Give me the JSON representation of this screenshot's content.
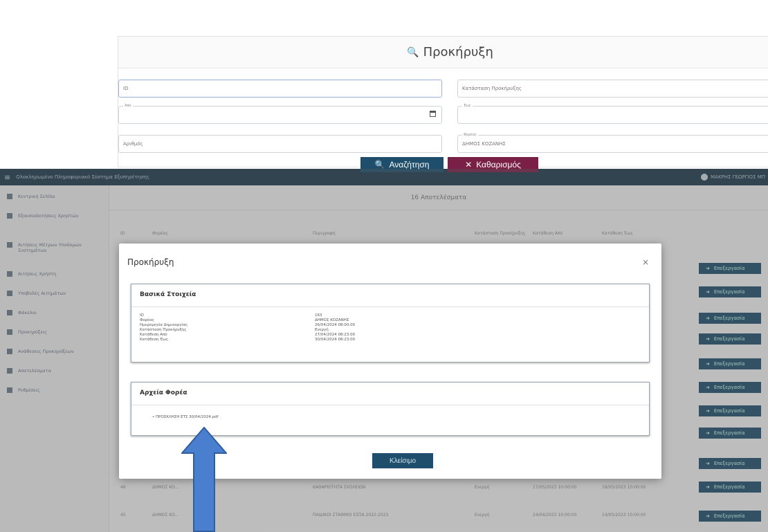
{
  "search": {
    "title": "Προκήρυξη",
    "fields": {
      "id": "ID",
      "description": "Κατάσταση Προκήρυξης",
      "from_label": "Από",
      "to_label": "Έως",
      "number": "Αριθμός",
      "carrier_label": "Φορέας",
      "carrier_value": "ΔΗΜΟΣ ΚΟΖΑΝΗΣ"
    },
    "search_button": "Αναζήτηση",
    "clear_button": "Καθαρισμός"
  },
  "app_bar": {
    "title": "Ολοκληρωμένο Πληροφοριακό Σύστημα Εξυπηρέτησης",
    "user": "ΜΑΚΡΗΣ ΓΕΩΡΓΙΟΣ ΜΠ"
  },
  "sidebar": {
    "items": [
      {
        "label": "Κεντρική Σελίδα",
        "icon": "home-icon"
      },
      {
        "label": "Εξουσιοδοτήσεις Χρηστών",
        "icon": "users-icon"
      },
      {
        "label": "Αιτήσεις Μέτρων Υποδομών Συστημάτων",
        "icon": "chart-icon"
      },
      {
        "label": "Αιτήσεις Χρήστη",
        "icon": "list-icon"
      },
      {
        "label": "Υποβολές Αιτημάτων",
        "icon": "filter-icon"
      },
      {
        "label": "Φάκελοι",
        "icon": "calendar-icon"
      },
      {
        "label": "Προκηρύξεις",
        "icon": "star-icon"
      },
      {
        "label": "Ανάθεσεις Προκηρύξεων",
        "icon": "key-icon"
      },
      {
        "label": "Αποτελέσματα",
        "icon": "check-icon"
      },
      {
        "label": "Ρυθμίσεις",
        "icon": "card-icon"
      }
    ]
  },
  "results": {
    "title": "16 Αποτελέσματα",
    "columns": [
      "ID",
      "Φορέας",
      "Περιγραφή",
      "Κατάσταση Προκήρυξης",
      "Κατάθεση Από",
      "Κατάθεση Έως"
    ],
    "edit_label": "Επεξεργασία",
    "rows": [
      [
        "46",
        "ΔΗΜΟΣ ΚΟ...",
        "ΚΑΘΑΡΙΟΤΗΤΑ ΣΧΟΛΕΙΩΝ",
        "Ενεργή",
        "17/05/2023 10:00:00",
        "18/05/2023 10:00:00"
      ],
      [
        "45",
        "ΔΗΜΟΣ ΚΟ...",
        "ΠΑΙΔΙΚΟΙ ΣΤΑΘΜΟΙ ΕΣΠΑ 2022-2023",
        "Ενεργή",
        "24/04/2023 10:00:00",
        "14/05/2023 10:00:00"
      ]
    ]
  },
  "modal": {
    "title": "Προκήρυξη",
    "basic_title": "Βασικά Στοιχεία",
    "labels": [
      "ID",
      "Φορέας",
      "Ημερομηνία Δημιουργίας",
      "Κατάσταση Προκήρυξης",
      "Κατάθεση Από",
      "Κατάθεση Έως"
    ],
    "values": [
      "163",
      "ΔΗΜΟΣ ΚΟΖΑΝΗΣ",
      "26/04/2024 08:00:00",
      "Ενεργή",
      "27/04/2024 08:23:00",
      "30/04/2024 08:23:00"
    ],
    "files_title": "Αρχεία Φορέα",
    "file_item": "• ΠΡΟΣΚΛΗΣΗ ΕΤΣ 30/04/2024.pdf",
    "close_button": "Κλείσιμο"
  },
  "colors": {
    "primary": "#1e4e6b",
    "danger": "#7a1f45",
    "appbar": "#1d3a4a",
    "arrow": "#4a7fd0"
  }
}
